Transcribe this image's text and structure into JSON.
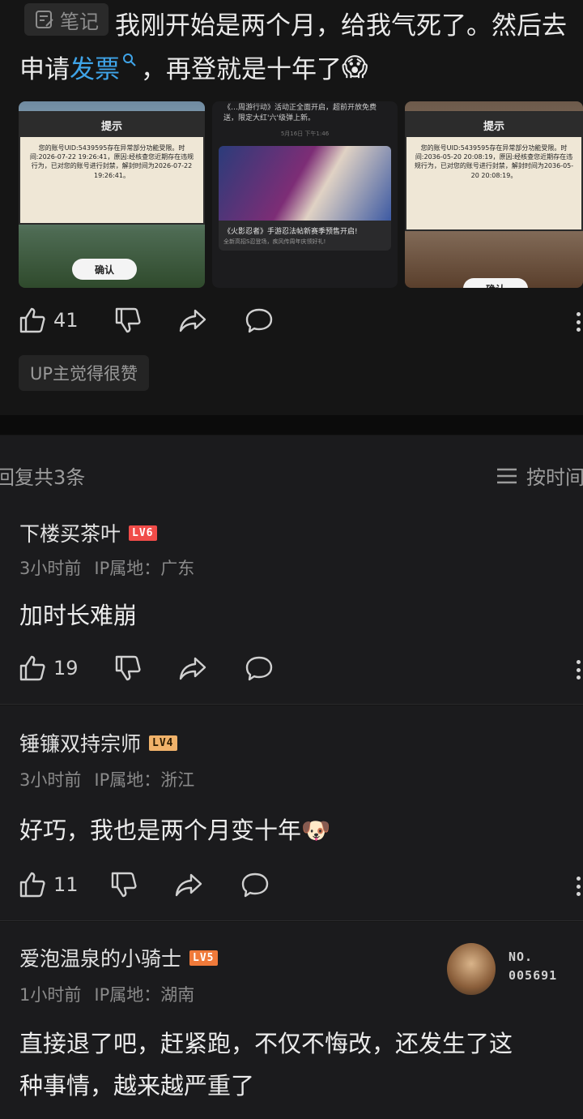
{
  "post": {
    "note_label": "笔记",
    "line1": "我刚开始是两个月，给我气死了。然后去",
    "line2_prefix": "申请",
    "link_text": "发票",
    "line2_suffix": "，再登就是十年了",
    "emoji": "😱",
    "images": [
      {
        "dialog_title": "提示",
        "dialog_text": "您的账号UID:5439595存在异常部分功能受限。时间:2026-07-22 19:26:41，原因:经核查您近期存在违规行为，已对您的账号进行封禁，解封时间为2026-07-22 19:26:41。",
        "button": "确认"
      },
      {
        "notice_text": "《…周游行动》活动正全面开启，超前开放免费送，限定大红'六'级弹上新。",
        "date": "5月16日 下午1:46",
        "promo_title": "《火影忍者》手游忍法帖新赛季预售开启!",
        "promo_sub": "全新高招S忍登场，疾风传周年庆领好礼!"
      },
      {
        "dialog_title": "提示",
        "dialog_text": "您的账号UID:5439595存在异常部分功能受限。时间:2036-05-20 20:08:19，原因:经核查您近期存在违规行为，已对您的账号进行封禁，解封时间为2036-05-20 20:08:19。",
        "button": "确认"
      }
    ],
    "likes": "41",
    "up_tag": "UP主觉得很赞"
  },
  "replies_header": {
    "count_text": "回复共3条",
    "sort_label": "按时间"
  },
  "comments": [
    {
      "username": "下楼买茶叶",
      "level": "LV6",
      "time": "3小时前",
      "ip": "IP属地：广东",
      "text": "加时长难崩",
      "likes": "19"
    },
    {
      "username": "锤镰双持宗师",
      "level": "LV4",
      "time": "3小时前",
      "ip": "IP属地：浙江",
      "text": "好巧，我也是两个月变十年",
      "emoji": "🐶",
      "likes": "11"
    },
    {
      "username": "爱泡温泉的小骑士",
      "level": "LV5",
      "time": "1小时前",
      "ip": "IP属地：湖南",
      "text_line1": "直接退了吧，赶紧跑，不仅不悔改，还发生了这",
      "text_line2": "种事情，越来越严重了",
      "fan_no_label": "NO.",
      "fan_no_value": "005691"
    }
  ],
  "icons": [
    "note-icon",
    "search-icon",
    "like-icon",
    "dislike-icon",
    "share-icon",
    "comment-icon",
    "more-icon",
    "sort-icon"
  ],
  "colors": {
    "background": "#151515",
    "link": "#3fa4e8",
    "lv6": "#f04c49",
    "lv4": "#f0b26a",
    "lv5": "#f07a3a"
  }
}
